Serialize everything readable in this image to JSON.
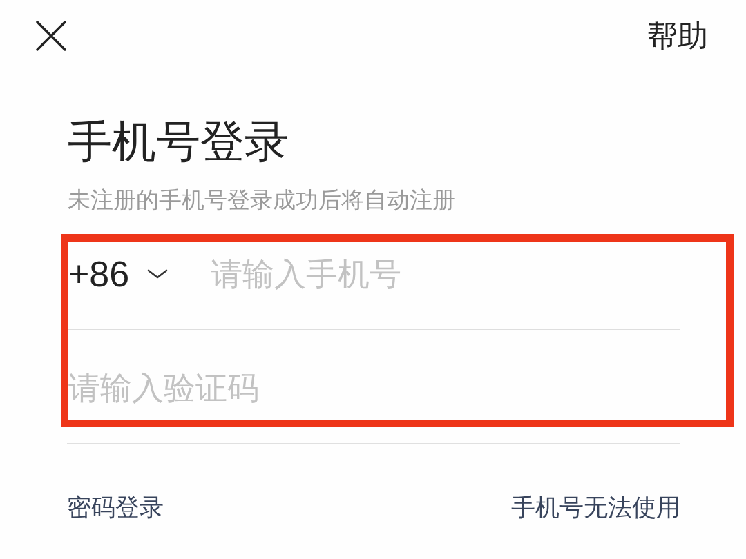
{
  "header": {
    "help": "帮助"
  },
  "title": "手机号登录",
  "subtitle": "未注册的手机号登录成功后将自动注册",
  "form": {
    "highlighted": true,
    "country_code": "+86",
    "phone": {
      "placeholder": "请输入手机号"
    },
    "code": {
      "placeholder": "请输入验证码"
    }
  },
  "footer": {
    "password_login": "密码登录",
    "phone_unavailable": "手机号无法使用"
  }
}
